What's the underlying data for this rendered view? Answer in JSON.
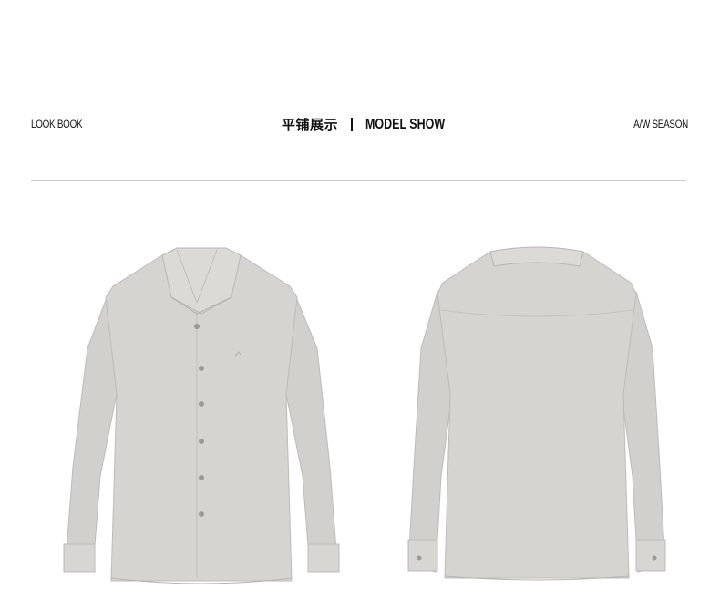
{
  "header": {
    "left_label": "LOOK BOOK",
    "title_cn": "平铺展示",
    "title_en": "MODEL SHOW",
    "right_label": "A/W SEASON"
  },
  "colors": {
    "shirt_body": "#d6d4d1",
    "shirt_shadow": "#c3c1be",
    "shirt_highlight": "#e2e0dd",
    "rule": "#c9c9c9",
    "text": "#111111"
  },
  "products": [
    {
      "view": "front",
      "icon": "shirt-front-image"
    },
    {
      "view": "back",
      "icon": "shirt-back-image"
    }
  ]
}
